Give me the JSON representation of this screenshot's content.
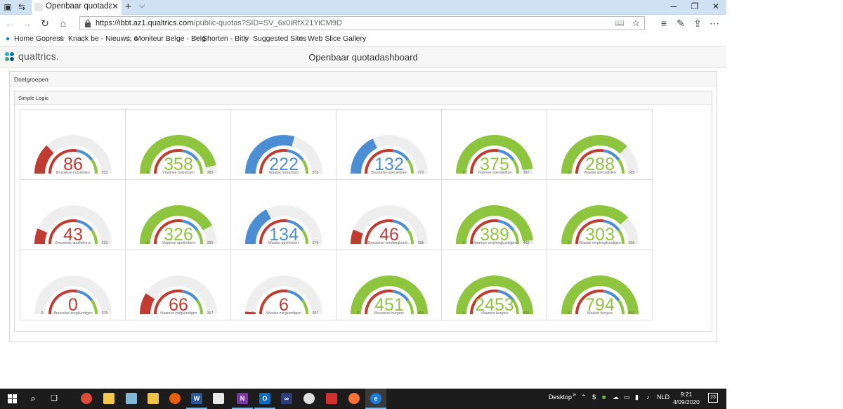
{
  "browser": {
    "tab_title": "Openbaar quotadashbo",
    "url_host": "https://ibbt.az1.qualtrics.com",
    "url_path": "/public-quotas?SID=SV_6x0iRfX21YiCM9D",
    "favorites": [
      "Home Gopress",
      "Knack be - Nieuws, o",
      "Moniteur Belge - Belg",
      "Shorten - Bitly",
      "Suggested Sites",
      "Web Slice Gallery"
    ]
  },
  "page": {
    "brand": "qualtrics.",
    "title": "Openbaar quotadashboard",
    "section": "Doelgroepen",
    "subsection": "Simple Logic"
  },
  "colors": {
    "red": "#c03b30",
    "blue": "#4b8ed4",
    "green": "#8dc53f",
    "track": "#eeeeee"
  },
  "gauges": [
    {
      "value": "86",
      "label": "Brusselse huisartsen",
      "min": "0",
      "max": "333",
      "fill": 0.26,
      "color": "red",
      "blue_arc": 0.55,
      "green_arc": 0.8
    },
    {
      "value": "358",
      "label": "Vlaamse huisartsen",
      "min": "0",
      "max": "385",
      "fill": 0.93,
      "color": "green",
      "blue_arc": 0.55,
      "green_arc": 0.8
    },
    {
      "value": "222",
      "label": "Waalse huisartsen",
      "min": "0",
      "max": "375",
      "fill": 0.59,
      "color": "blue",
      "blue_arc": 0.55,
      "green_arc": 0.8
    },
    {
      "value": "132",
      "label": "Brusselse specialisten",
      "min": "0",
      "max": "370",
      "fill": 0.36,
      "color": "blue",
      "blue_arc": 0.55,
      "green_arc": 0.8
    },
    {
      "value": "375",
      "label": "Vlaamse specialisten",
      "min": "0",
      "max": "392",
      "fill": 0.96,
      "color": "green",
      "blue_arc": 0.55,
      "green_arc": 0.8
    },
    {
      "value": "288",
      "label": "Waalse specialisten",
      "min": "0",
      "max": "385",
      "fill": 0.75,
      "color": "green",
      "blue_arc": 0.55,
      "green_arc": 0.8
    },
    {
      "value": "43",
      "label": "Brusselse apothekers",
      "min": "0",
      "max": "333",
      "fill": 0.13,
      "color": "red",
      "blue_arc": 0.55,
      "green_arc": 0.8
    },
    {
      "value": "326",
      "label": "Vlaamse apothekers",
      "min": "0",
      "max": "390",
      "fill": 0.84,
      "color": "green",
      "blue_arc": 0.55,
      "green_arc": 0.8
    },
    {
      "value": "134",
      "label": "Waalse apothekers",
      "min": "0",
      "max": "378",
      "fill": 0.35,
      "color": "blue",
      "blue_arc": 0.55,
      "green_arc": 0.8
    },
    {
      "value": "46",
      "label": "Brusselse verpleegkund...",
      "min": "0",
      "max": "385",
      "fill": 0.12,
      "color": "red",
      "blue_arc": 0.55,
      "green_arc": 0.8
    },
    {
      "value": "389",
      "label": "Vlaamse verpleegkundigen",
      "min": "0",
      "max": "400",
      "fill": 0.97,
      "color": "green",
      "blue_arc": 0.55,
      "green_arc": 0.8
    },
    {
      "value": "303",
      "label": "Waalse verpleegkundigen",
      "min": "0",
      "max": "398",
      "fill": 0.76,
      "color": "green",
      "blue_arc": 0.55,
      "green_arc": 0.8
    },
    {
      "value": "0",
      "label": "Brusselse zorgkundigen",
      "min": "0",
      "max": "375",
      "fill": 0.0,
      "color": "red",
      "blue_arc": 0.55,
      "green_arc": 0.8
    },
    {
      "value": "66",
      "label": "Vlaamse zorgkundigen",
      "min": "0",
      "max": "367",
      "fill": 0.18,
      "color": "red",
      "blue_arc": 0.55,
      "green_arc": 0.8
    },
    {
      "value": "6",
      "label": "Waalse zorgkundigen",
      "min": "0",
      "max": "397",
      "fill": 0.02,
      "color": "red",
      "blue_arc": 0.55,
      "green_arc": 0.8
    },
    {
      "value": "451",
      "label": "Brusselse burgers",
      "min": "0",
      "max": "400",
      "fill": 1.0,
      "color": "green",
      "blue_arc": 0.55,
      "green_arc": 0.8
    },
    {
      "value": "2453",
      "label": "Vlaamse burgers",
      "min": "0",
      "max": "400",
      "fill": 1.0,
      "color": "green",
      "blue_arc": 0.55,
      "green_arc": 0.8
    },
    {
      "value": "794",
      "label": "Waalse burgers",
      "min": "0",
      "max": "460",
      "fill": 1.0,
      "color": "green",
      "blue_arc": 0.55,
      "green_arc": 0.8
    }
  ],
  "taskbar": {
    "desktop_label": "Desktop",
    "language": "NLD",
    "time": "9:21",
    "date": "4/09/2020",
    "notifications": "23"
  }
}
